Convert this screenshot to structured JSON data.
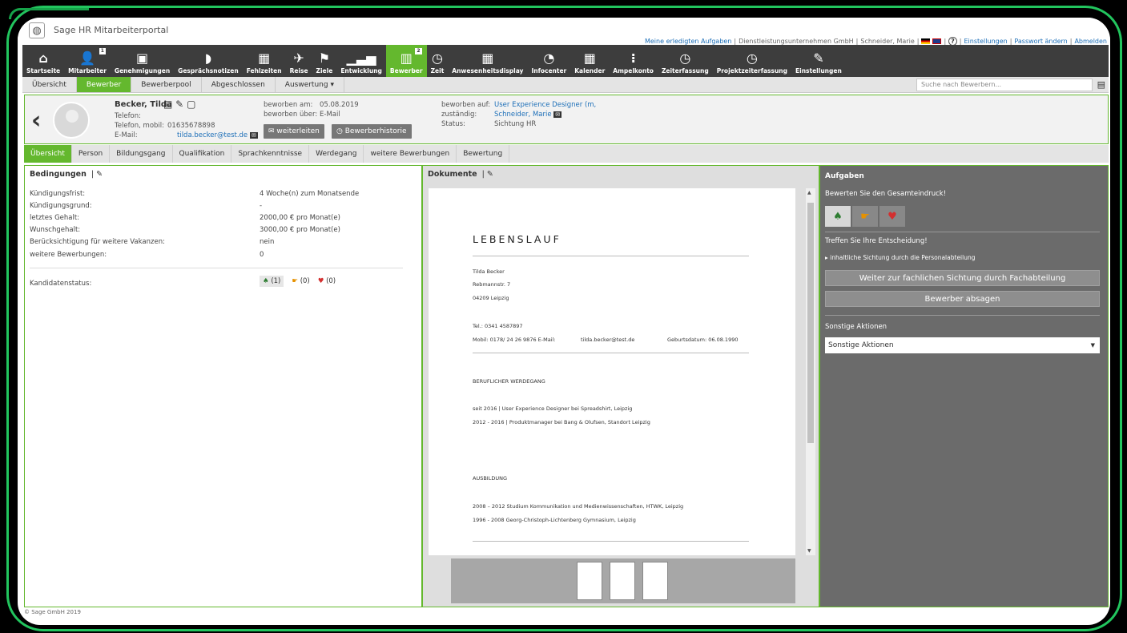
{
  "app": {
    "title": "Sage HR Mitarbeiterportal",
    "footer": "© Sage GmbH 2019"
  },
  "toplinks": {
    "done_tasks": "Meine erledigten Aufgaben",
    "company": "Dienstleistungsunternehmen GmbH",
    "user": "Schneider, Marie",
    "help": "?",
    "settings": "Einstellungen",
    "password": "Passwort ändern",
    "logout": "Abmelden"
  },
  "mainnav": [
    {
      "label": "Startseite",
      "icon": "⌂",
      "name": "home-icon"
    },
    {
      "label": "Mitarbeiter",
      "icon": "👤",
      "name": "employee-icon",
      "badge": "1"
    },
    {
      "label": "Genehmigungen",
      "icon": "▣",
      "name": "approval-icon"
    },
    {
      "label": "Gesprächsnotizen",
      "icon": "◗",
      "name": "notes-icon"
    },
    {
      "label": "Fehlzeiten",
      "icon": "▦",
      "name": "calendar-icon"
    },
    {
      "label": "Reise",
      "icon": "✈",
      "name": "plane-icon"
    },
    {
      "label": "Ziele",
      "icon": "⚑",
      "name": "flag-icon"
    },
    {
      "label": "Entwicklung",
      "icon": "▁▃▅",
      "name": "chart-icon"
    },
    {
      "label": "Bewerber",
      "icon": "▥",
      "name": "applicant-icon",
      "badge": "2",
      "active": true
    },
    {
      "label": "Zeit",
      "icon": "◷",
      "name": "time-icon"
    },
    {
      "label": "Anwesenheitsdisplay",
      "icon": "▦",
      "name": "grid-icon"
    },
    {
      "label": "Infocenter",
      "icon": "◔",
      "name": "pie-icon"
    },
    {
      "label": "Kalender",
      "icon": "▦",
      "name": "calendar-icon"
    },
    {
      "label": "Ampelkonto",
      "icon": "⁝",
      "name": "traffic-light-icon"
    },
    {
      "label": "Zeiterfassung",
      "icon": "◷",
      "name": "clock-icon"
    },
    {
      "label": "Projektzeiterfassung",
      "icon": "◷",
      "name": "project-time-icon"
    },
    {
      "label": "Einstellungen",
      "icon": "✎",
      "name": "wrench-icon"
    }
  ],
  "subnav": {
    "tabs": [
      "Übersicht",
      "Bewerber",
      "Bewerberpool",
      "Abgeschlossen",
      "Auswertung ▾"
    ],
    "search_placeholder": "Suche nach Bewerbern..."
  },
  "candidate": {
    "name": "Becker, Tilda",
    "phone_label": "Telefon:",
    "phone": "",
    "mobile_label": "Telefon, mobil:",
    "mobile": "01635678898",
    "email_label": "E-Mail:",
    "email": "tilda.becker@test.de",
    "applied_on_label": "beworben am:",
    "applied_on": "05.08.2019",
    "applied_via_label": "beworben über:",
    "applied_via": "E-Mail",
    "forward_btn": "weiterleiten",
    "history_btn": "Bewerberhistorie",
    "position_label": "beworben auf:",
    "position": "User Experience Designer (m,",
    "responsible_label": "zuständig:",
    "responsible": "Schneider, Marie",
    "status_label": "Status:",
    "status": "Sichtung HR"
  },
  "detail_tabs": [
    "Übersicht",
    "Person",
    "Bildungsgang",
    "Qualifikation",
    "Sprachkenntnisse",
    "Werdegang",
    "weitere Bewerbungen",
    "Bewertung"
  ],
  "conditions": {
    "title": "Bedingungen",
    "rows": [
      {
        "k": "Kündigungsfrist:",
        "v": "4 Woche(n) zum Monatsende"
      },
      {
        "k": "Kündigungsgrund:",
        "v": "-"
      },
      {
        "k": "letztes Gehalt:",
        "v": "2000,00 € pro Monat(e)"
      },
      {
        "k": "Wunschgehalt:",
        "v": "3000,00 € pro Monat(e)"
      },
      {
        "k": "Berücksichtigung für weitere Vakanzen:",
        "v": "nein"
      },
      {
        "k": "weitere Bewerbungen:",
        "v": "0"
      }
    ],
    "status_label": "Kandidatenstatus:",
    "rating_good": "(1)",
    "rating_neutral": "(0)",
    "rating_bad": "(0)"
  },
  "documents": {
    "title": "Dokumente",
    "heading": "LEBENSLAUF",
    "name": "Tilda Becker",
    "street": "Rebmannstr. 7",
    "city": "04209 Leipzig",
    "tel": "Tel.: 0341 4587897",
    "mobile": "Mobil: 0178/ 24 26 9876 E-Mail:",
    "email": "tilda.becker@test.de",
    "birth": "Geburtsdatum: 06.08.1990",
    "career_title": "BERUFLICHER WERDEGANG",
    "career1": "seit 2016    | User Experience Designer bei Spreadshirt, Leipzig",
    "career2": " 2012 - 2016 | Produktmanager bei Bang & Olufsen, Standort Leipzig",
    "edu_title": "AUSBILDUNG",
    "edu1": "2008 – 2012  Studium Kommunikation und Medienwissenschaften, HTWK, Leipzig",
    "edu2": "1996 - 2008  Georg-Christoph-Lichtenberg Gymnasium, Leipzig"
  },
  "tasks": {
    "title": "Aufgaben",
    "rate_prompt": "Bewerten Sie den Gesamteindruck!",
    "decision_prompt": "Treffen Sie Ihre Entscheidung!",
    "decision_option": "inhaltliche Sichtung durch die Personalabteilung",
    "forward_btn": "Weiter zur fachlichen Sichtung durch Fachabteilung",
    "reject_btn": "Bewerber absagen",
    "other_title": "Sonstige Aktionen",
    "other_select": "Sonstige Aktionen"
  },
  "colors": {
    "accent": "#64b82e",
    "nav": "#3d3d3d",
    "frame": "#22c55e"
  }
}
